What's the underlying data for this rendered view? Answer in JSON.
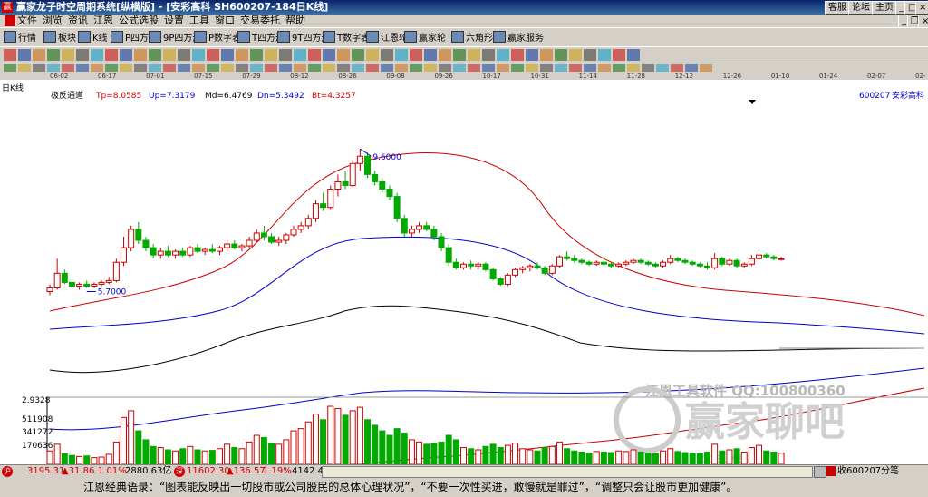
{
  "titlebar": {
    "title": "赢家龙子时空周期系统[纵横版] - [安彩高科  SH600207-184日K线]",
    "btn_mail": "客服",
    "btn_forum": "论坛",
    "btn_home": "主页",
    "btn_min": "_",
    "btn_max": "□",
    "btn_close": "×",
    "btn_sub_min": "_",
    "btn_sub_restore": "❐",
    "btn_sub_close": "×"
  },
  "menu": [
    "文件",
    "浏览",
    "资讯",
    "江恩",
    "公式选股",
    "设置",
    "工具",
    "窗口",
    "交易委托",
    "帮助"
  ],
  "toolbar1": [
    {
      "label": "行情",
      "icon": "grid-icon"
    },
    {
      "label": "板块",
      "icon": "blocks-icon"
    },
    {
      "label": "K线",
      "icon": "candle-icon"
    },
    {
      "label": "P四方形",
      "icon": "square-p-icon"
    },
    {
      "label": "9P四方形",
      "icon": "square-9p-icon"
    },
    {
      "label": "P数字表",
      "icon": "table-p-icon"
    },
    {
      "label": "T四方形",
      "icon": "square-t-icon"
    },
    {
      "label": "9T四方形",
      "icon": "square-9t-icon"
    },
    {
      "label": "T数字表",
      "icon": "table-t-icon"
    },
    {
      "label": "江恩轮",
      "icon": "gann-wheel-icon"
    },
    {
      "label": "赢家轮",
      "icon": "winner-wheel-icon"
    },
    {
      "label": "六角形",
      "icon": "hexagon-icon"
    },
    {
      "label": "赢家服务",
      "icon": "service-icon"
    }
  ],
  "time_axis": [
    "06-02",
    "06-17",
    "07-01",
    "07-15",
    "07-29",
    "08-12",
    "08-26",
    "09-08",
    "09-26",
    "10-17",
    "10-31",
    "11-14",
    "11-28",
    "12-12",
    "12-26",
    "01-10",
    "01-24",
    "02-07",
    "02-21"
  ],
  "chart_header": {
    "period": "日K线",
    "indicator": "极反通道",
    "tp": "Tp=8.0585",
    "up": "Up=7.3179",
    "md": "Md=6.4769",
    "dn": "Dn=5.3492",
    "bt": "Bt=4.3257",
    "code": "600207",
    "name": "安彩高科"
  },
  "watermark": {
    "line1": "江恩工具软件  QQ:100800360",
    "line2": "赢家聊吧",
    "url": "jiaoba.yes"
  },
  "volume_axis": [
    "2.9328",
    "511908",
    "341272",
    "170636"
  ],
  "chart_data": {
    "type": "candlestick",
    "annotations": {
      "high": "9.6000",
      "low": "5.7000"
    },
    "ohlc": [
      [
        5.7,
        5.9,
        5.6,
        5.8
      ],
      [
        5.8,
        6.6,
        5.75,
        6.2
      ],
      [
        6.2,
        6.3,
        5.9,
        5.95
      ],
      [
        5.95,
        6.05,
        5.8,
        5.85
      ],
      [
        5.85,
        5.95,
        5.75,
        5.9
      ],
      [
        5.9,
        6.0,
        5.8,
        5.85
      ],
      [
        5.85,
        5.95,
        5.8,
        5.9
      ],
      [
        5.9,
        6.0,
        5.85,
        5.95
      ],
      [
        5.95,
        6.1,
        5.9,
        6.0
      ],
      [
        6.0,
        6.6,
        5.95,
        6.5
      ],
      [
        6.5,
        7.2,
        6.4,
        6.9
      ],
      [
        6.9,
        7.5,
        6.8,
        7.4
      ],
      [
        7.4,
        7.6,
        7.0,
        7.1
      ],
      [
        7.1,
        7.2,
        6.8,
        6.9
      ],
      [
        6.9,
        7.0,
        6.6,
        6.7
      ],
      [
        6.7,
        6.9,
        6.6,
        6.8
      ],
      [
        6.8,
        6.95,
        6.65,
        6.7
      ],
      [
        6.7,
        6.85,
        6.6,
        6.8
      ],
      [
        6.8,
        6.9,
        6.65,
        6.7
      ],
      [
        6.7,
        6.95,
        6.65,
        6.9
      ],
      [
        6.9,
        7.0,
        6.75,
        6.8
      ],
      [
        6.8,
        6.9,
        6.7,
        6.85
      ],
      [
        6.85,
        7.0,
        6.75,
        6.8
      ],
      [
        6.8,
        6.95,
        6.7,
        6.9
      ],
      [
        6.9,
        7.1,
        6.8,
        7.0
      ],
      [
        7.0,
        7.1,
        6.85,
        6.9
      ],
      [
        6.9,
        7.0,
        6.8,
        6.95
      ],
      [
        6.95,
        7.2,
        6.9,
        7.1
      ],
      [
        7.1,
        7.4,
        7.05,
        7.3
      ],
      [
        7.3,
        7.5,
        7.1,
        7.2
      ],
      [
        7.2,
        7.3,
        7.0,
        7.05
      ],
      [
        7.05,
        7.2,
        6.95,
        7.1
      ],
      [
        7.1,
        7.3,
        7.0,
        7.25
      ],
      [
        7.25,
        7.5,
        7.2,
        7.4
      ],
      [
        7.4,
        7.6,
        7.3,
        7.5
      ],
      [
        7.5,
        7.8,
        7.4,
        7.7
      ],
      [
        7.7,
        8.2,
        7.6,
        8.1
      ],
      [
        8.1,
        8.4,
        7.9,
        8.0
      ],
      [
        8.0,
        8.6,
        7.95,
        8.5
      ],
      [
        8.5,
        8.9,
        8.3,
        8.7
      ],
      [
        8.7,
        9.0,
        8.5,
        8.6
      ],
      [
        8.6,
        9.3,
        8.55,
        9.2
      ],
      [
        9.2,
        9.6,
        9.0,
        9.4
      ],
      [
        9.4,
        9.5,
        8.8,
        8.9
      ],
      [
        8.9,
        9.0,
        8.6,
        8.7
      ],
      [
        8.7,
        8.8,
        8.4,
        8.5
      ],
      [
        8.5,
        8.6,
        8.2,
        8.3
      ],
      [
        8.3,
        8.4,
        7.6,
        7.7
      ],
      [
        7.7,
        7.8,
        7.2,
        7.3
      ],
      [
        7.3,
        7.5,
        7.2,
        7.4
      ],
      [
        7.4,
        7.6,
        7.3,
        7.5
      ],
      [
        7.5,
        7.6,
        7.35,
        7.4
      ],
      [
        7.4,
        7.5,
        7.1,
        7.2
      ],
      [
        7.2,
        7.3,
        6.8,
        6.9
      ],
      [
        6.9,
        7.0,
        6.4,
        6.5
      ],
      [
        6.5,
        6.6,
        6.3,
        6.35
      ],
      [
        6.35,
        6.5,
        6.3,
        6.45
      ],
      [
        6.45,
        6.55,
        6.3,
        6.4
      ],
      [
        6.4,
        6.5,
        6.3,
        6.45
      ],
      [
        6.45,
        6.5,
        6.25,
        6.3
      ],
      [
        6.3,
        6.35,
        6.0,
        6.05
      ],
      [
        6.05,
        6.1,
        5.85,
        5.9
      ],
      [
        5.9,
        6.2,
        5.85,
        6.15
      ],
      [
        6.15,
        6.35,
        6.1,
        6.3
      ],
      [
        6.3,
        6.4,
        6.2,
        6.35
      ],
      [
        6.35,
        6.45,
        6.25,
        6.4
      ],
      [
        6.4,
        6.5,
        6.3,
        6.35
      ],
      [
        6.35,
        6.4,
        6.15,
        6.2
      ],
      [
        6.2,
        6.45,
        6.15,
        6.4
      ],
      [
        6.4,
        6.7,
        6.35,
        6.65
      ],
      [
        6.65,
        6.8,
        6.55,
        6.6
      ],
      [
        6.6,
        6.7,
        6.5,
        6.55
      ],
      [
        6.55,
        6.6,
        6.45,
        6.5
      ],
      [
        6.5,
        6.55,
        6.4,
        6.45
      ],
      [
        6.45,
        6.55,
        6.4,
        6.5
      ],
      [
        6.5,
        6.6,
        6.4,
        6.45
      ],
      [
        6.45,
        6.5,
        6.35,
        6.4
      ],
      [
        6.4,
        6.5,
        6.35,
        6.45
      ],
      [
        6.45,
        6.55,
        6.4,
        6.5
      ],
      [
        6.5,
        6.6,
        6.45,
        6.55
      ],
      [
        6.55,
        6.6,
        6.45,
        6.5
      ],
      [
        6.5,
        6.55,
        6.4,
        6.45
      ],
      [
        6.45,
        6.5,
        6.35,
        6.4
      ],
      [
        6.4,
        6.55,
        6.35,
        6.5
      ],
      [
        6.5,
        6.7,
        6.45,
        6.6
      ],
      [
        6.6,
        6.65,
        6.5,
        6.55
      ],
      [
        6.55,
        6.6,
        6.45,
        6.5
      ],
      [
        6.5,
        6.55,
        6.4,
        6.45
      ],
      [
        6.45,
        6.5,
        6.35,
        6.4
      ],
      [
        6.4,
        6.5,
        6.3,
        6.35
      ],
      [
        6.35,
        6.75,
        6.3,
        6.6
      ],
      [
        6.6,
        6.65,
        6.4,
        6.45
      ],
      [
        6.45,
        6.6,
        6.4,
        6.55
      ],
      [
        6.55,
        6.6,
        6.35,
        6.4
      ],
      [
        6.4,
        6.5,
        6.35,
        6.45
      ],
      [
        6.45,
        6.7,
        6.4,
        6.6
      ],
      [
        6.6,
        6.75,
        6.55,
        6.7
      ],
      [
        6.7,
        6.75,
        6.6,
        6.65
      ],
      [
        6.65,
        6.7,
        6.55,
        6.6
      ],
      [
        6.6,
        6.65,
        6.55,
        6.6
      ]
    ],
    "volume": [
      120,
      180,
      95,
      80,
      70,
      75,
      60,
      65,
      90,
      200,
      420,
      480,
      300,
      220,
      160,
      150,
      130,
      120,
      140,
      160,
      130,
      120,
      125,
      140,
      180,
      150,
      140,
      200,
      260,
      240,
      190,
      180,
      220,
      300,
      320,
      380,
      450,
      400,
      520,
      500,
      440,
      480,
      511,
      400,
      350,
      300,
      260,
      320,
      280,
      220,
      200,
      180,
      190,
      200,
      260,
      220,
      150,
      140,
      130,
      160,
      180,
      150,
      170,
      190,
      140,
      130,
      120,
      150,
      160,
      200,
      140,
      120,
      110,
      100,
      115,
      110,
      105,
      120,
      115,
      130,
      110,
      100,
      95,
      120,
      140,
      115,
      105,
      100,
      95,
      110,
      180,
      120,
      130,
      140,
      110,
      150,
      170,
      120,
      110,
      100
    ],
    "channels": {
      "tp": "8.0585",
      "up": "7.3179",
      "md": "6.4769",
      "dn": "5.3492",
      "bt": "4.3257"
    }
  },
  "status_bar": {
    "sh_index": "3195.31",
    "sh_change": "▲31.86",
    "sh_pct": "1.01%",
    "sh_amount": "2880.63亿",
    "sz_index": "11602.30",
    "sz_change": "▲136.57",
    "sz_pct": "1.19%",
    "sz_amount": "4142.4",
    "right_text": "收600207分笔"
  },
  "quote_bar": "江恩经典语录：“图表能反映出一切股市或公司股民的总体心理状况”，“不要一次性买进，敢慢就是罪过”，“调整只会让股市更加健康”。"
}
